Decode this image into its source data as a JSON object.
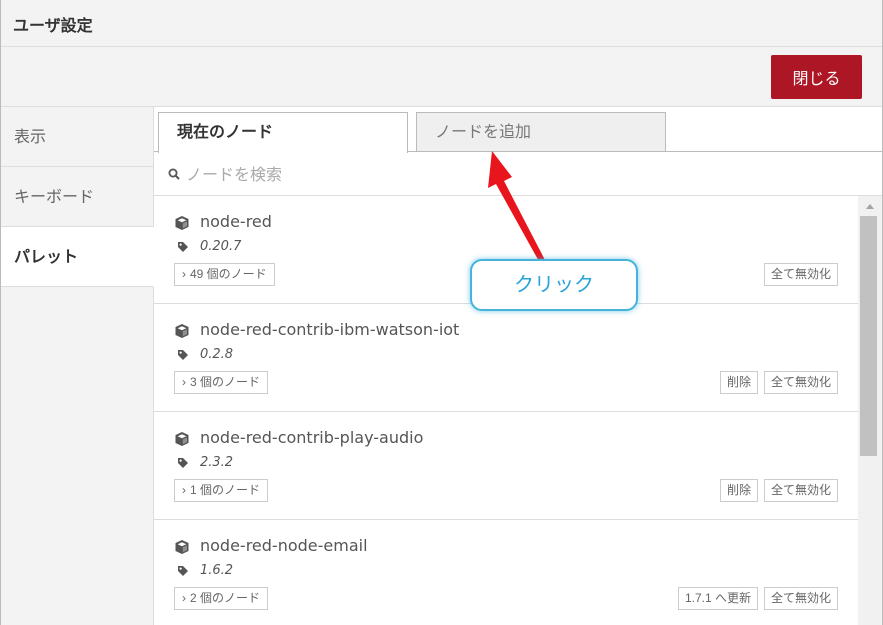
{
  "dialog": {
    "title": "ユーザ設定",
    "close_label": "閉じる"
  },
  "sidebar": {
    "items": [
      {
        "label": "表示"
      },
      {
        "label": "キーボード"
      },
      {
        "label": "パレット"
      }
    ]
  },
  "tabs": {
    "current": "現在のノード",
    "add": "ノードを追加"
  },
  "search": {
    "placeholder": "ノードを検索"
  },
  "nodes": [
    {
      "name": "node-red",
      "version": "0.20.7",
      "count": "49 個のノード",
      "actions": [
        "全て無効化"
      ]
    },
    {
      "name": "node-red-contrib-ibm-watson-iot",
      "version": "0.2.8",
      "count": "3 個のノード",
      "actions": [
        "削除",
        "全て無効化"
      ]
    },
    {
      "name": "node-red-contrib-play-audio",
      "version": "2.3.2",
      "count": "1 個のノード",
      "actions": [
        "削除",
        "全て無効化"
      ]
    },
    {
      "name": "node-red-node-email",
      "version": "1.6.2",
      "count": "2 個のノード",
      "actions": [
        "1.7.1 へ更新",
        "全て無効化"
      ]
    }
  ],
  "annotation": {
    "callout_text": "クリック",
    "color": "#e8161c"
  },
  "colors": {
    "close_button": "#ad1625",
    "callout_border": "#45b3da"
  }
}
